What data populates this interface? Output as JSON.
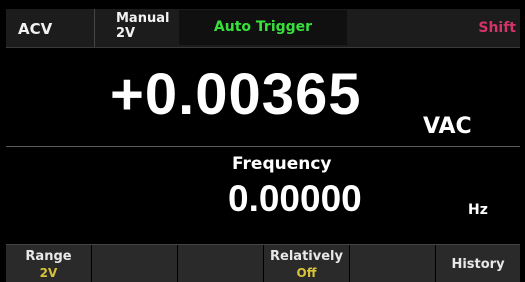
{
  "status_bar": {
    "mode": "ACV",
    "range_mode_line1": "Manual",
    "range_mode_line2": "2V",
    "trigger": "Auto Trigger",
    "shift": "Shift"
  },
  "main_display": {
    "value": "+0.00365",
    "unit": "VAC"
  },
  "secondary_display": {
    "title": "Frequency",
    "value": "0.00000",
    "unit": "Hz"
  },
  "softkeys": [
    {
      "label": "Range",
      "value": "2V"
    },
    {
      "label": "",
      "value": ""
    },
    {
      "label": "",
      "value": ""
    },
    {
      "label": "Relatively",
      "value": "Off"
    },
    {
      "label": "",
      "value": ""
    },
    {
      "label": "History",
      "value": ""
    }
  ],
  "colors": {
    "trigger": "#38e03c",
    "shift": "#d4336a",
    "softkey_value": "#d6c33a"
  }
}
